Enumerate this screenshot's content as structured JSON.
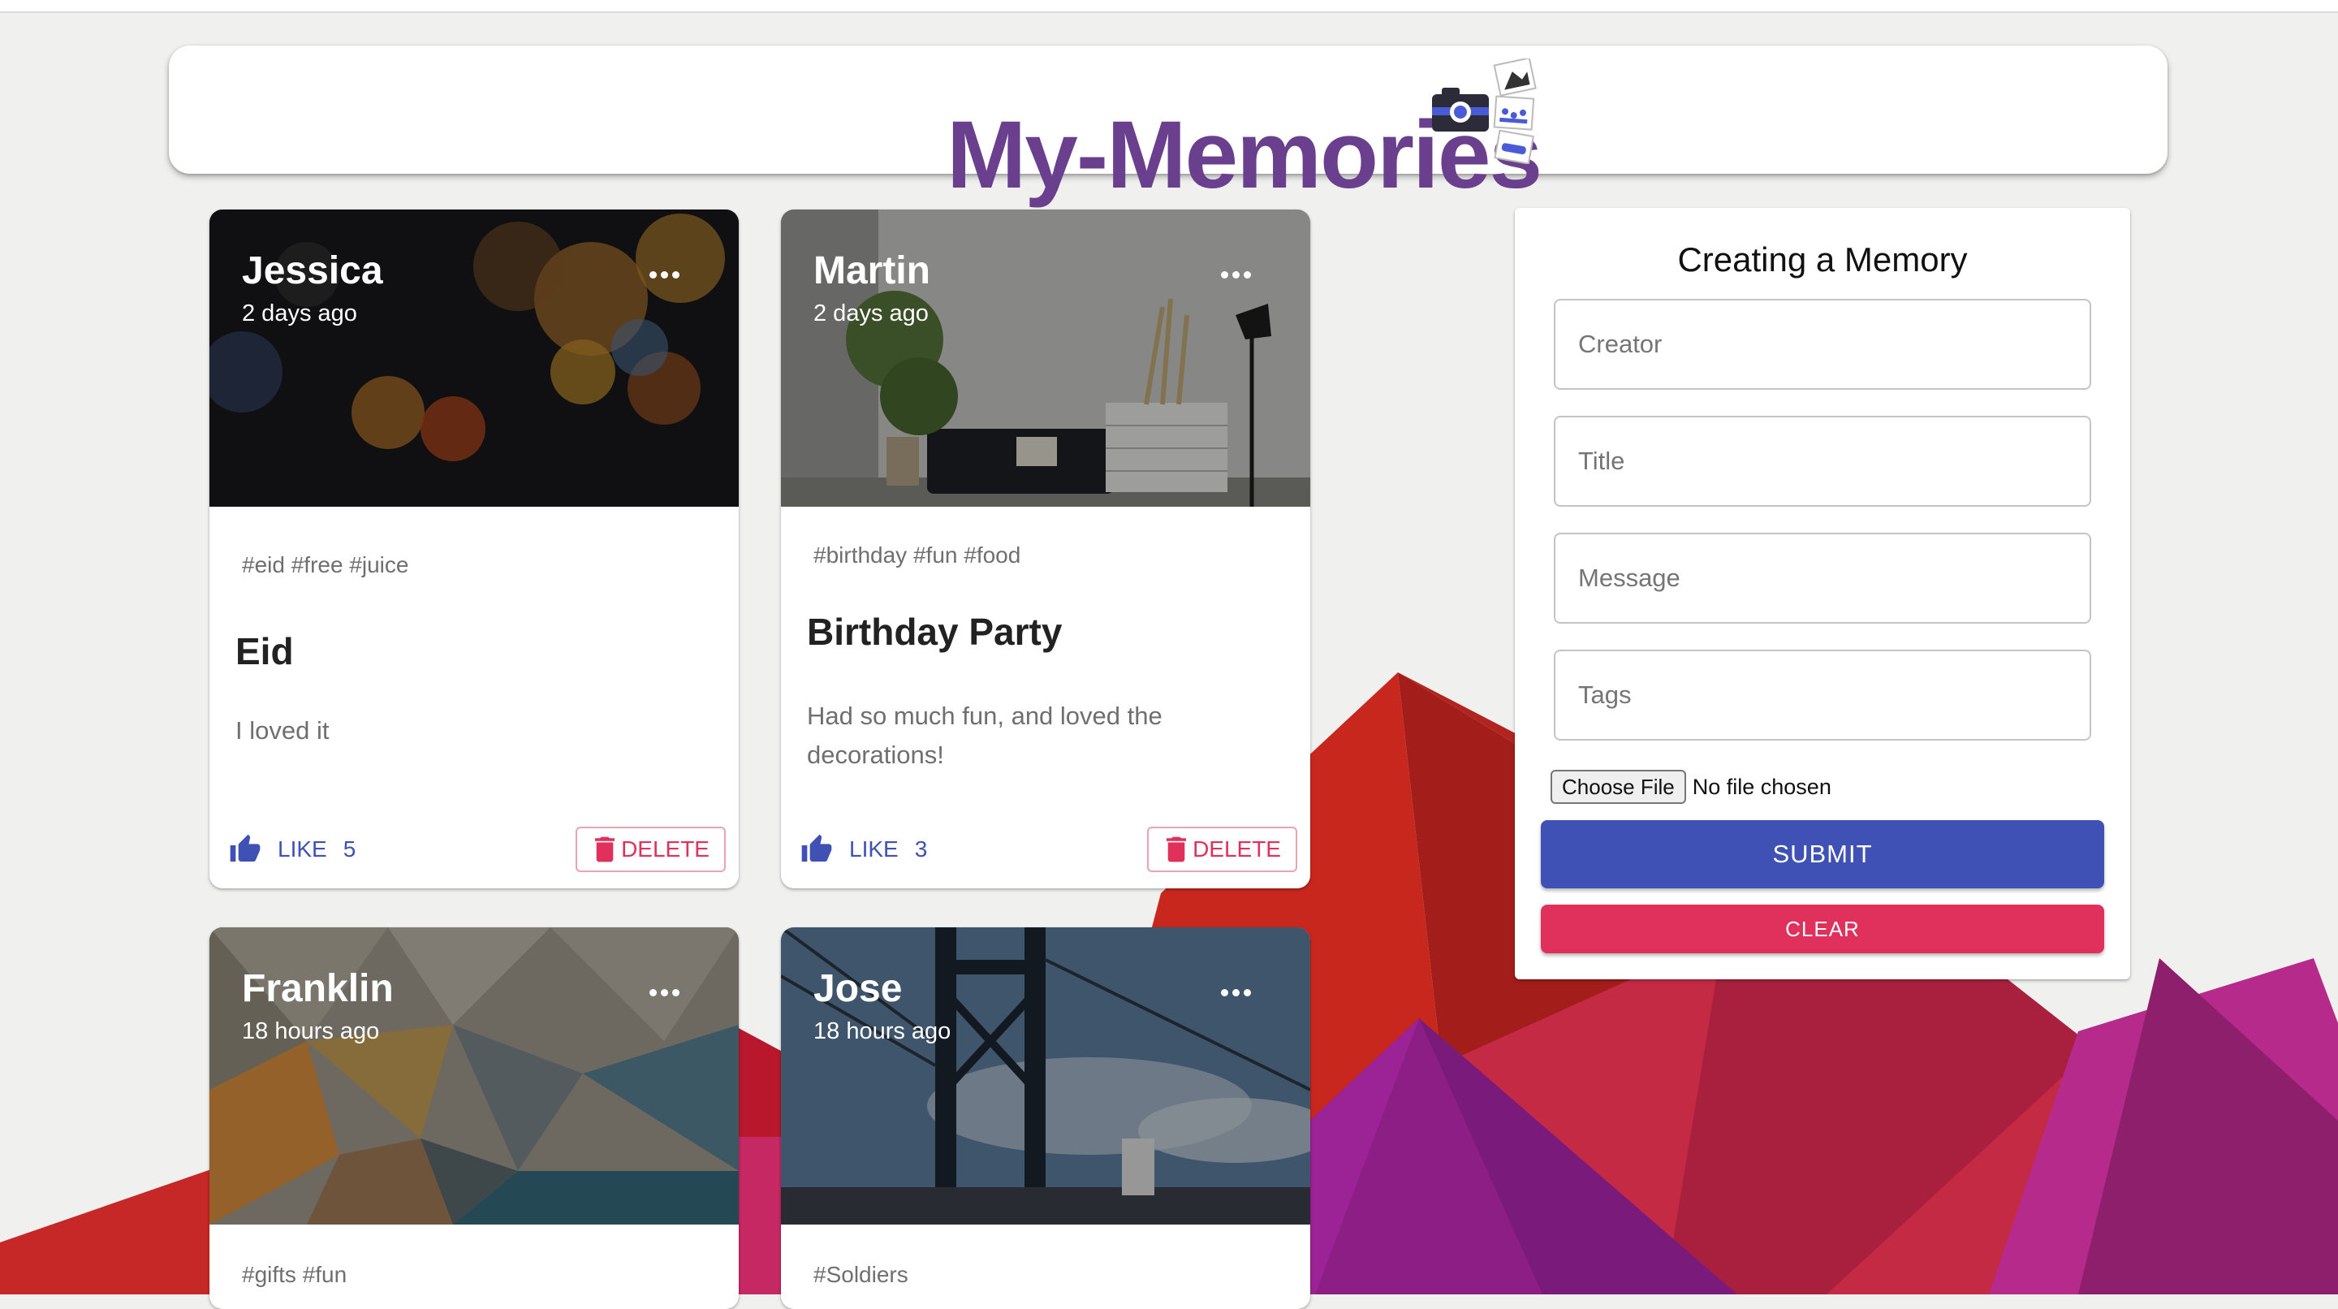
{
  "app": {
    "title": "My-Memories",
    "logo_icon": "camera-photos-icon",
    "title_color": "#6a3f8e"
  },
  "posts": [
    {
      "creator": "Jessica",
      "time": "2 days ago",
      "tags": "#eid #free #juice",
      "title": "Eid",
      "message": "I loved it",
      "like_label": "LIKE",
      "like_count": "5",
      "delete_label": "DELETE"
    },
    {
      "creator": "Martin",
      "time": "2 days ago",
      "tags": "#birthday #fun #food",
      "title": "Birthday Party",
      "message": "Had so much fun, and loved the decorations!",
      "like_label": "LIKE",
      "like_count": "3",
      "delete_label": "DELETE"
    },
    {
      "creator": "Franklin",
      "time": "18 hours ago",
      "tags": "#gifts #fun"
    },
    {
      "creator": "Jose",
      "time": "18 hours ago",
      "tags": "#Soldiers"
    }
  ],
  "form": {
    "heading": "Creating a Memory",
    "creator_placeholder": "Creator",
    "title_placeholder": "Title",
    "message_placeholder": "Message",
    "tags_placeholder": "Tags",
    "choose_file_label": "Choose File",
    "file_status": "No file chosen",
    "submit_label": "SUBMIT",
    "clear_label": "CLEAR"
  },
  "colors": {
    "primary": "#3f51b5",
    "secondary": "#e0315d",
    "background": "#f0f0ee"
  }
}
